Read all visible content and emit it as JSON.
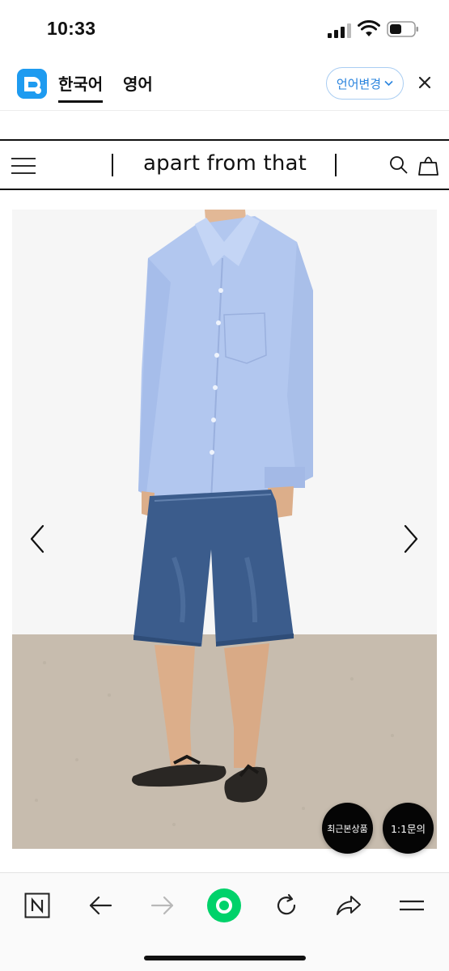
{
  "status_bar": {
    "time": "10:33"
  },
  "translate_bar": {
    "tabs": [
      {
        "label": "한국어",
        "active": true
      },
      {
        "label": "영어",
        "active": false
      }
    ],
    "change_language_label": "언어변경",
    "accent_color": "#2a84de"
  },
  "site_header": {
    "brand": "apart from that"
  },
  "product": {
    "image_description_icons": [
      "shirt",
      "denim-shorts",
      "flip-flops"
    ]
  },
  "floating_buttons": {
    "recent": "최근본상품",
    "inquiry": "1:1문의"
  },
  "toolbar": {
    "icons": [
      "naver-n-icon",
      "back-arrow-icon",
      "forward-arrow-icon",
      "home-dot-icon",
      "reload-icon",
      "share-icon",
      "menu-icon"
    ],
    "home_color": "#00d26a"
  }
}
